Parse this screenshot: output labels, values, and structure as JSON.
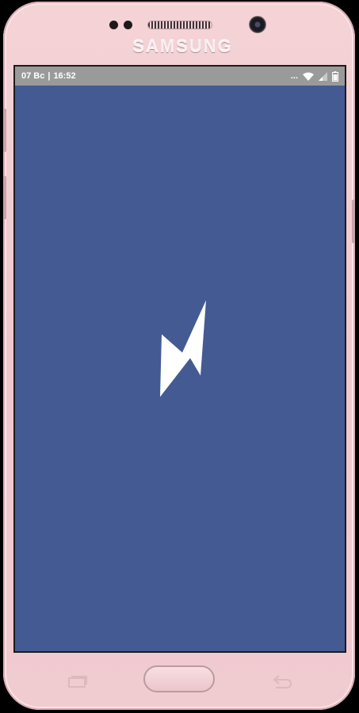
{
  "device": {
    "brand": "SAMSUNG",
    "color_body": "#f2cdd2"
  },
  "statusbar": {
    "date": "07 Вс",
    "separator": "|",
    "time": "16:52",
    "more": "...",
    "icons": [
      "wifi-icon",
      "signal-icon",
      "battery-icon"
    ],
    "color": "#9a9a9a"
  },
  "screen": {
    "background": "#445a93",
    "logo_icon": "lightning-bolt-icon",
    "logo_color": "#ffffff"
  },
  "navbar": {
    "icons": [
      "recent-apps-icon",
      "home-button",
      "back-icon"
    ]
  }
}
